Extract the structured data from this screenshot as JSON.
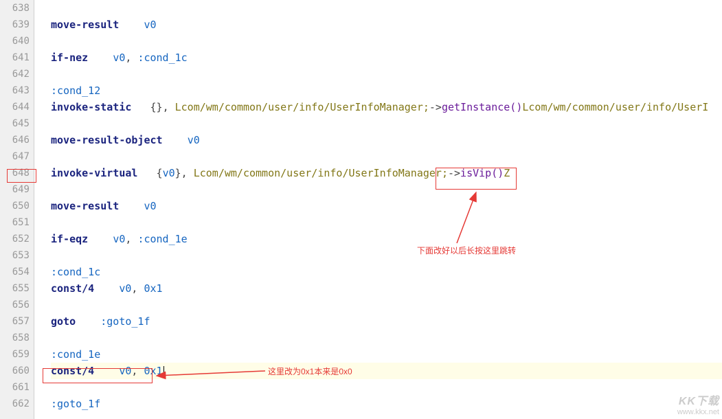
{
  "lines": {
    "638": "638",
    "639": "639",
    "640": "640",
    "641": "641",
    "642": "642",
    "643": "643",
    "644": "644",
    "645": "645",
    "646": "646",
    "647": "647",
    "648": "648",
    "649": "649",
    "650": "650",
    "651": "651",
    "652": "652",
    "653": "653",
    "654": "654",
    "655": "655",
    "656": "656",
    "657": "657",
    "658": "658",
    "659": "659",
    "660": "660",
    "661": "661",
    "662": "662"
  },
  "code": {
    "l639": {
      "op": "move-result",
      "reg": "v0"
    },
    "l641": {
      "op": "if-nez",
      "reg": "v0",
      "comma": ", ",
      "label": ":cond_1c"
    },
    "l643": {
      "label": ":cond_12"
    },
    "l644": {
      "op": "invoke-static",
      "braces": "{}",
      "comma": ", ",
      "type": "Lcom/wm/common/user/info/UserInfoManager;",
      "arrow": "->",
      "method": "getInstance()",
      "rettype": "Lcom/wm/common/user/info/UserI"
    },
    "l646": {
      "op": "move-result-object",
      "reg": "v0"
    },
    "l648": {
      "op": "invoke-virtual",
      "lb": "{",
      "reg": "v0",
      "rb": "}",
      "comma": ", ",
      "type": "Lcom/wm/common/user/info/UserInfoManager;",
      "arrow": "->",
      "method": "isVip()",
      "ret": "Z"
    },
    "l650": {
      "op": "move-result",
      "reg": "v0"
    },
    "l652": {
      "op": "if-eqz",
      "reg": "v0",
      "comma": ", ",
      "label": ":cond_1e"
    },
    "l654": {
      "label": ":cond_1c"
    },
    "l655": {
      "op": "const/4",
      "reg": "v0",
      "comma": ", ",
      "lit": "0x1"
    },
    "l657": {
      "op": "goto",
      "label": ":goto_1f"
    },
    "l659": {
      "label": ":cond_1e"
    },
    "l660": {
      "op": "const/4",
      "reg": "v0",
      "comma": ", ",
      "lit": "0x1"
    },
    "l662": {
      "label": ":goto_1f"
    }
  },
  "annotations": {
    "a1": "下面改好以后长按这里跳转",
    "a2": "这里改为0x1本来是0x0"
  },
  "watermark": {
    "brand": "KK下载",
    "url": "www.kkx.net"
  }
}
